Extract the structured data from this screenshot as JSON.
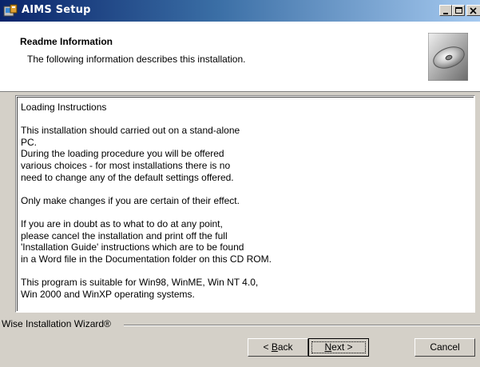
{
  "window": {
    "title": "AIMS Setup",
    "minimize_icon": "minimize-icon",
    "maximize_icon": "maximize-icon",
    "close_icon": "close-icon"
  },
  "header": {
    "title": "Readme Information",
    "description": "The following information describes this installation.",
    "logo": "cd-icon"
  },
  "readme": {
    "lines": [
      "Loading Instructions",
      "",
      "This installation should carried out on a stand-alone",
      "PC.",
      "During the loading procedure you will be offered",
      "various choices - for most installations there is no",
      "need to change any of the default settings offered.",
      "",
      "Only make changes if you are certain of their effect.",
      "",
      "If you are in doubt as to what to do at any point,",
      "please cancel the installation and print off the full",
      "'Installation Guide' instructions which are to be found",
      "in a Word file in the Documentation folder on this CD ROM.",
      "",
      "This program is suitable for Win98, WinME, Win NT 4.0,",
      "Win 2000 and WinXP operating systems."
    ]
  },
  "footer": {
    "brand": "Wise Installation Wizard®",
    "back_prefix": "< ",
    "back_key": "B",
    "back_rest": "ack",
    "next_key": "N",
    "next_rest": "ext >",
    "cancel_label": "Cancel"
  }
}
